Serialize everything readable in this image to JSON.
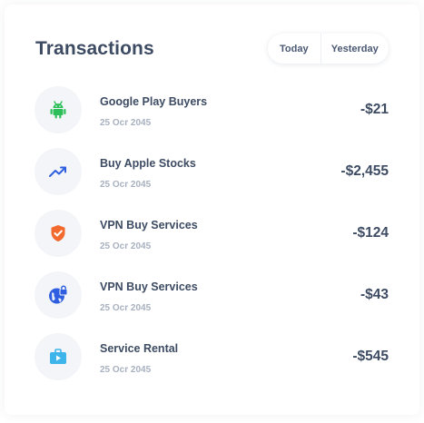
{
  "header": {
    "title": "Transactions",
    "tabs": [
      {
        "label": "Today"
      },
      {
        "label": "Yesterday"
      }
    ]
  },
  "transactions": [
    {
      "icon": "android-icon",
      "icon_color": "#2fbf5a",
      "name": "Google Play Buyers",
      "date": "25 Ocr 2045",
      "amount": "-$21"
    },
    {
      "icon": "trending-up-icon",
      "icon_color": "#2f5fe0",
      "name": "Buy Apple Stocks",
      "date": "25 Ocr 2045",
      "amount": "-$2,455"
    },
    {
      "icon": "shield-check-icon",
      "icon_color": "#f26a2e",
      "name": "VPN Buy Services",
      "date": "25 Ocr 2045",
      "amount": "-$124"
    },
    {
      "icon": "globe-lock-icon",
      "icon_color": "#2f5fe0",
      "name": "VPN Buy Services",
      "date": "25 Ocr 2045",
      "amount": "-$43"
    },
    {
      "icon": "briefcase-play-icon",
      "icon_color": "#3db4ea",
      "name": "Service Rental",
      "date": "25 Ocr 2045",
      "amount": "-$545"
    }
  ]
}
